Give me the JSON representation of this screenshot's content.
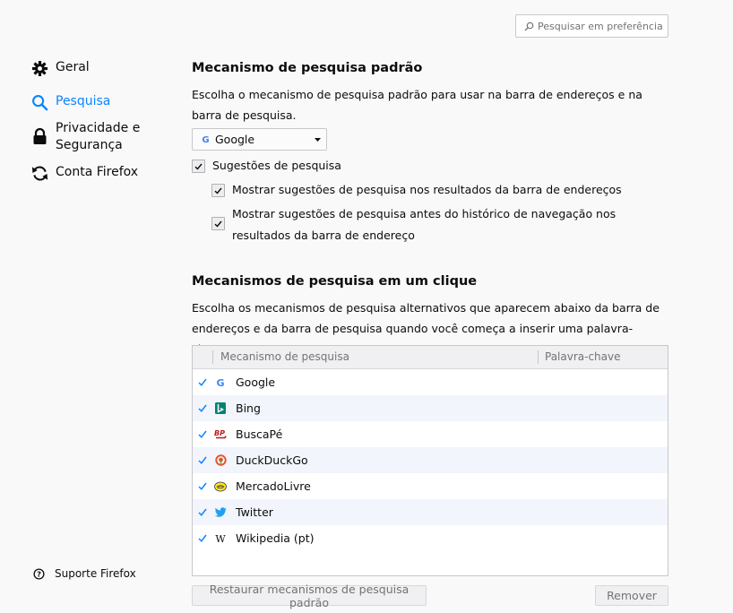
{
  "search": {
    "placeholder": "Pesquisar em preferências"
  },
  "sidebar": {
    "items": [
      {
        "label": "Geral",
        "icon": "gear-icon"
      },
      {
        "label": "Pesquisa",
        "icon": "search-icon",
        "active": true
      },
      {
        "label": "Privacidade e\nSegurança",
        "icon": "lock-icon"
      },
      {
        "label": "Conta Firefox",
        "icon": "sync-icon"
      }
    ],
    "support_label": "Suporte Firefox"
  },
  "default_engine": {
    "title": "Mecanismo de pesquisa padrão",
    "description": "Escolha o mecanismo de pesquisa padrão para usar na barra de endereços e na barra de pesquisa.",
    "selected": "Google",
    "suggestions_label": "Sugestões de pesquisa",
    "suggestions_checked": true,
    "show_in_urlbar_label": "Mostrar sugestões de pesquisa nos resultados da barra de endereços",
    "show_in_urlbar_checked": true,
    "show_before_history_label": "Mostrar sugestões de pesquisa antes do histórico de navegação nos resultados da barra de endereço",
    "show_before_history_checked": true
  },
  "one_click": {
    "title": "Mecanismos de pesquisa em um clique",
    "description": "Escolha os mecanismos de pesquisa alternativos que aparecem abaixo da barra de endereços e da barra de pesquisa quando você começa a inserir uma palavra-chave.",
    "col_engine": "Mecanismo de pesquisa",
    "col_keyword": "Palavra-chave",
    "engines": [
      {
        "name": "Google",
        "checked": true,
        "icon": "google-icon"
      },
      {
        "name": "Bing",
        "checked": true,
        "icon": "bing-icon"
      },
      {
        "name": "BuscaPé",
        "checked": true,
        "icon": "buscape-icon"
      },
      {
        "name": "DuckDuckGo",
        "checked": true,
        "icon": "duckduckgo-icon"
      },
      {
        "name": "MercadoLivre",
        "checked": true,
        "icon": "mercadolivre-icon"
      },
      {
        "name": "Twitter",
        "checked": true,
        "icon": "twitter-icon"
      },
      {
        "name": "Wikipedia (pt)",
        "checked": true,
        "icon": "wikipedia-icon"
      }
    ],
    "restore_label": "Restaurar mecanismos de pesquisa padrão",
    "remove_label": "Remover"
  },
  "colors": {
    "accent": "#0a84ff",
    "background": "#f9f9fa",
    "row_alt": "#f2f5fb"
  }
}
